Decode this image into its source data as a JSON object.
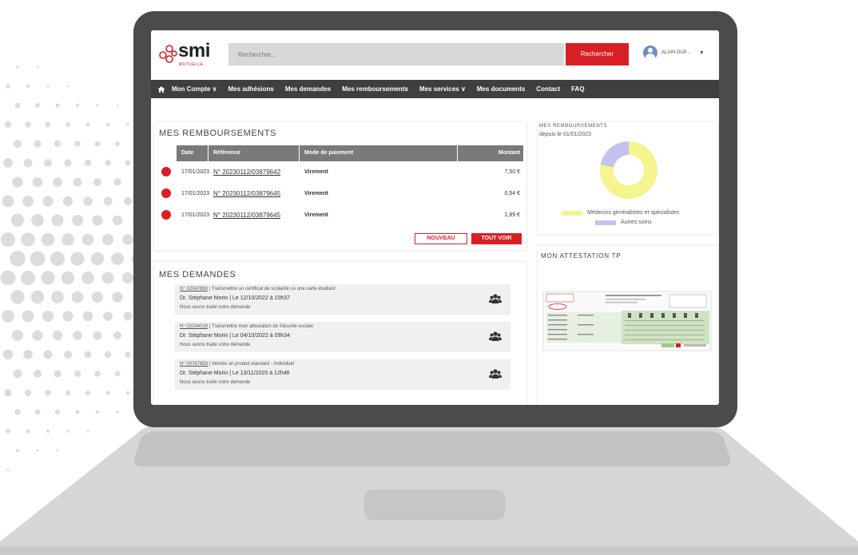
{
  "header": {
    "logo_text": "smi",
    "logo_sub": "MUTUELLE",
    "search_placeholder": "Rechercher...",
    "search_button": "Rechercher",
    "user_name": "ALAIN DUP...",
    "user_caret": "▼"
  },
  "nav": {
    "home_icon": "home-icon",
    "items": [
      "Mon Compte ∨",
      "Mes adhésions",
      "Mes demandes",
      "Mes remboursements",
      "Mes services ∨",
      "Mes documents",
      "Contact",
      "FAQ"
    ]
  },
  "remboursements": {
    "title": "MES  REMBOURSEMENTS",
    "columns": [
      "Date",
      "Référence",
      "Mode de paiement",
      "Montant"
    ],
    "rows": [
      {
        "date": "17/01/2023",
        "ref": "N° 20230112/03879642",
        "mode": "Virement",
        "amount": "7,50 €"
      },
      {
        "date": "17/01/2023",
        "ref": "N° 20230112/03879645",
        "mode": "Virement",
        "amount": "0,54 €"
      },
      {
        "date": "17/01/2023",
        "ref": "N° 20230112/03879645",
        "mode": "Virement",
        "amount": "1,89 €"
      }
    ],
    "btn_new": "NOUVEAU",
    "btn_all": "TOUT VOIR",
    "status_color": "#d91f26"
  },
  "demandes": {
    "title": "MES DEMANDES",
    "items": [
      {
        "num": "N° 02047660",
        "desc": " | Transmettre un certificat de scolarité ou une carte étudiant",
        "author": "Dr. Stéphane Morin  | Le 12/10/2022 à 10h37",
        "status": "Nous avons traité votre demande"
      },
      {
        "num": "N° 02034018",
        "desc": " | Transmettre mon attestation de Sécurité sociale",
        "author": "Dr. Stéphane Morin  | Le 04/10/2022 à 09h34",
        "status": "Nous avons traité votre demande"
      },
      {
        "num": "N° 00787653",
        "desc": " | Vendre un produit standard - Individuel",
        "author": "Dr. Stéphane Morin  | Le 13/11/2020 à 12h46",
        "status": "Nous avons traité votre demande"
      }
    ]
  },
  "chart_panel": {
    "title": "MES REMBOURSEMENTS",
    "subtitle": "depuis le 01/01/2023",
    "legend": [
      {
        "label": "Médecins généralistes et spécialistes",
        "color": "#f5f590"
      },
      {
        "label": "Autres soins",
        "color": "#c3c3f2"
      }
    ]
  },
  "chart_data": {
    "type": "pie",
    "categories": [
      "Médecins généralistes et spécialistes",
      "Autres soins"
    ],
    "values": [
      78,
      22
    ],
    "colors": [
      "#f5f590",
      "#c3c3f2"
    ],
    "title": "MES REMBOURSEMENTS",
    "subtitle": "depuis le 01/01/2023",
    "legend_position": "bottom"
  },
  "attestation": {
    "title": "MON  ATTESTATION TP"
  },
  "colors": {
    "brand_red": "#d91f26",
    "nav_bg": "#3f3f41",
    "laptop": "#4b4b4d"
  }
}
